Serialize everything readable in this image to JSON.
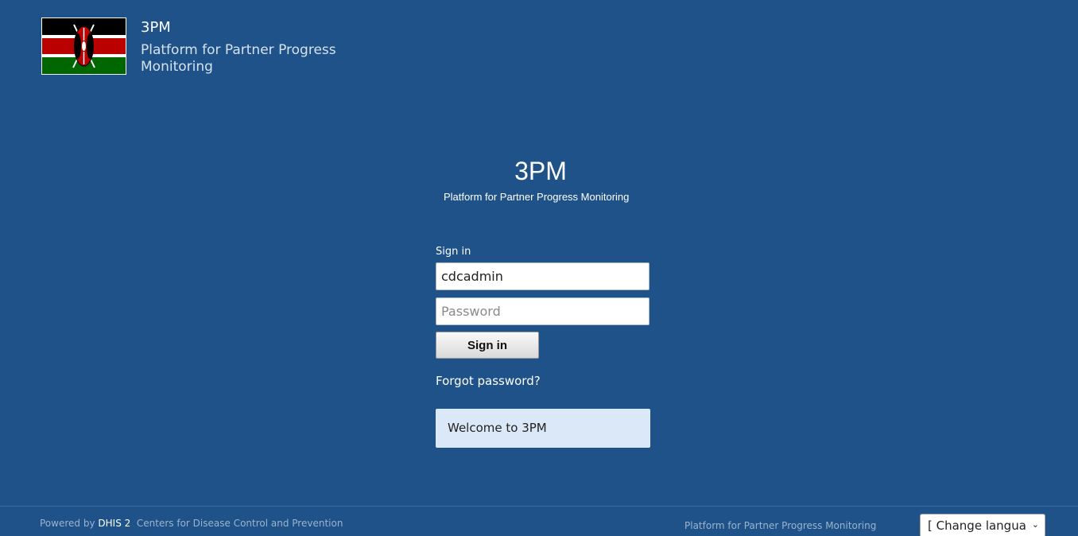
{
  "header": {
    "flag_name": "Kenya flag",
    "title": "3PM",
    "subtitle": "Platform for Partner Progress Monitoring"
  },
  "center": {
    "title": "3PM",
    "subtitle": "Platform for Partner Progress Monitoring"
  },
  "login": {
    "signin_label": "Sign in",
    "username_value": "cdcadmin",
    "password_placeholder": "Password",
    "signin_button": "Sign in",
    "forgot_link": "Forgot password?",
    "welcome_text": "Welcome to 3PM"
  },
  "footer": {
    "powered_by_prefix": "Powered by",
    "powered_by_brand": "DHIS 2",
    "organization": "Centers for Disease Control and Prevention",
    "app_name": "Platform for Partner Progress Monitoring",
    "language_select": "[ Change langua"
  },
  "colors": {
    "background": "#1e5288",
    "welcome_box": "#dbe8f7",
    "footer_text": "#9bb4cf"
  }
}
